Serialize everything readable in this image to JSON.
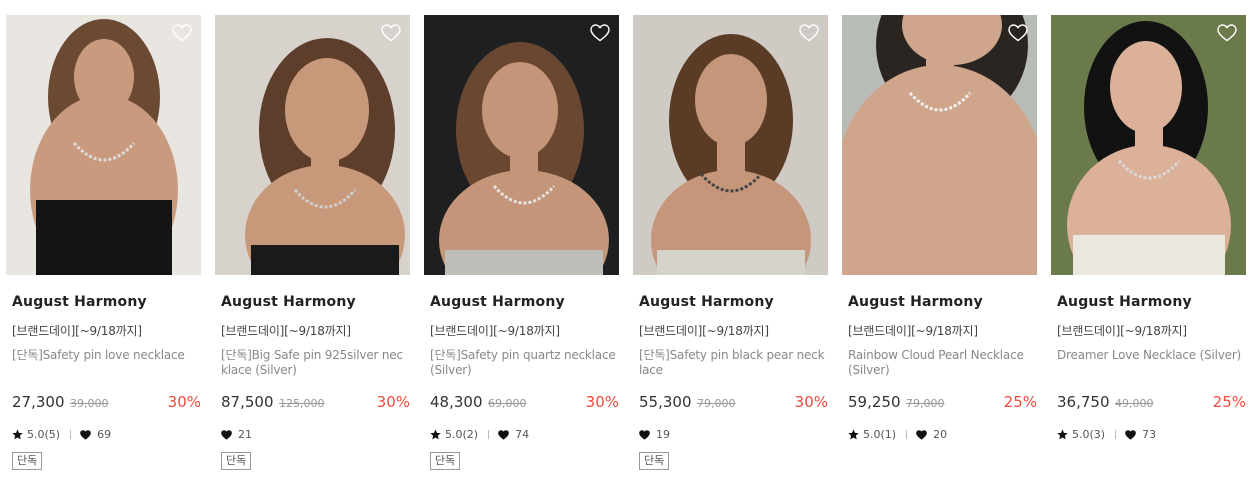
{
  "products": [
    {
      "brand": "August Harmony",
      "promo": "[브랜드데이][~9/18까지]",
      "name": "[단독]Safety pin love necklace",
      "price": "27,300",
      "original_price": "39,000",
      "discount": "30%",
      "rating": "5.0(5)",
      "likes": "69",
      "badge": "단독",
      "wishlist_icon": "heart-outline-icon"
    },
    {
      "brand": "August Harmony",
      "promo": "[브랜드데이][~9/18까지]",
      "name": "[단독]Big Safe pin 925silver necklace (Silver)",
      "price": "87,500",
      "original_price": "125,000",
      "discount": "30%",
      "rating": "",
      "likes": "21",
      "badge": "단독",
      "wishlist_icon": "heart-outline-icon"
    },
    {
      "brand": "August Harmony",
      "promo": "[브랜드데이][~9/18까지]",
      "name": "[단독]Safety pin quartz necklace (Silver)",
      "price": "48,300",
      "original_price": "69,000",
      "discount": "30%",
      "rating": "5.0(2)",
      "likes": "74",
      "badge": "단독",
      "wishlist_icon": "heart-outline-icon"
    },
    {
      "brand": "August Harmony",
      "promo": "[브랜드데이][~9/18까지]",
      "name": "[단독]Safety pin black pear necklace",
      "price": "55,300",
      "original_price": "79,000",
      "discount": "30%",
      "rating": "",
      "likes": "19",
      "badge": "단독",
      "wishlist_icon": "heart-outline-icon"
    },
    {
      "brand": "August Harmony",
      "promo": "[브랜드데이][~9/18까지]",
      "name": "Rainbow Cloud Pearl Necklace (Silver)",
      "price": "59,250",
      "original_price": "79,000",
      "discount": "25%",
      "rating": "5.0(1)",
      "likes": "20",
      "badge": "",
      "wishlist_icon": "heart-outline-icon"
    },
    {
      "brand": "August Harmony",
      "promo": "[브랜드데이][~9/18까지]",
      "name": "Dreamer Love Necklace (Silver)",
      "price": "36,750",
      "original_price": "49,000",
      "discount": "25%",
      "rating": "5.0(3)",
      "likes": "73",
      "badge": "",
      "wishlist_icon": "heart-outline-icon"
    }
  ],
  "icons": {
    "rating": "star-icon",
    "likes": "heart-filled-icon"
  },
  "colors": {
    "discount": "#ee4a3b",
    "price": "#333333",
    "brand": "#222222",
    "product_name": "#888888"
  }
}
